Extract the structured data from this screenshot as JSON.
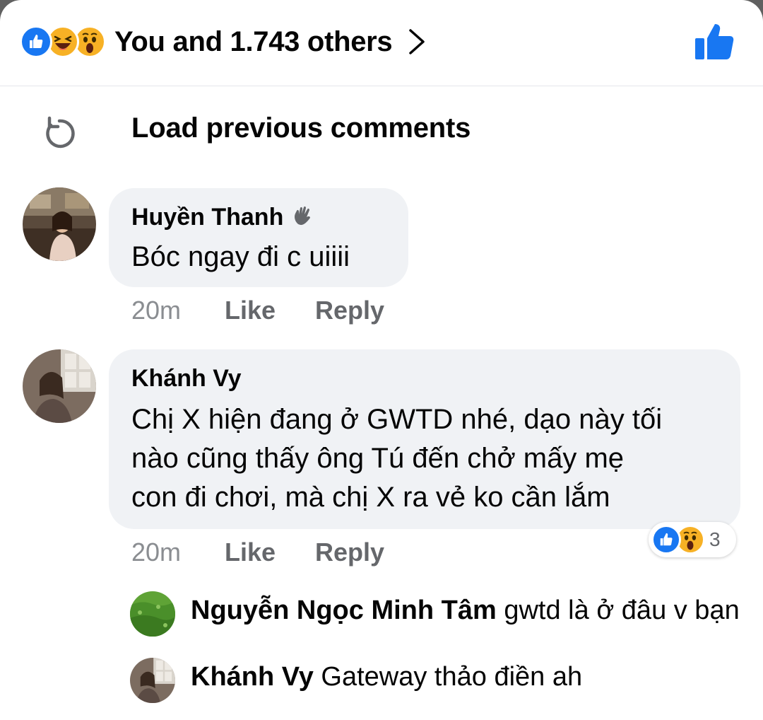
{
  "header": {
    "reactions": [
      "like-icon",
      "haha-icon",
      "wow-icon"
    ],
    "summary": "You and 1.743 others",
    "liked_icon": "thumbs-up-icon"
  },
  "load_previous": {
    "icon": "refresh-icon",
    "label": "Load previous comments"
  },
  "comments": [
    {
      "author": "Huyền Thanh",
      "badge_icon": "waving-hand-icon",
      "text": "Bóc ngay đi c uiiii",
      "time": "20m",
      "like_label": "Like",
      "reply_label": "Reply"
    },
    {
      "author": "Khánh Vy",
      "text_lines": [
        "Chị X hiện đang ở GWTD nhé, dạo này tối",
        "nào cũng thấy ông Tú đến chở mấy mẹ",
        "con đi chơi, mà chị X ra vẻ ko cần lắm"
      ],
      "time": "20m",
      "like_label": "Like",
      "reply_label": "Reply",
      "reactions": [
        "like-icon",
        "wow-icon"
      ],
      "reaction_count": "3",
      "replies": [
        {
          "author": "Nguyễn Ngọc Minh Tâm",
          "text": "gwtd là ở đâu v bạn"
        },
        {
          "author": "Khánh Vy",
          "text": "Gateway thảo điền ah"
        }
      ]
    }
  ],
  "colors": {
    "accent": "#1877f2",
    "bubble": "#f0f2f5",
    "meta_text": "#65676b",
    "text": "#050505"
  }
}
